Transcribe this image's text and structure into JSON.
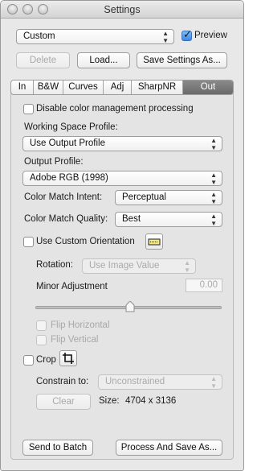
{
  "window": {
    "title": "Settings"
  },
  "top": {
    "preset_value": "Custom",
    "preview_label": "Preview",
    "preview_checked": true,
    "delete_label": "Delete",
    "load_label": "Load...",
    "save_label": "Save Settings As..."
  },
  "tabs": [
    {
      "label": "In"
    },
    {
      "label": "B&W"
    },
    {
      "label": "Curves"
    },
    {
      "label": "Adj"
    },
    {
      "label": "SharpNR"
    },
    {
      "label": "Out",
      "active": true
    }
  ],
  "out": {
    "disable_cm_label": "Disable color management processing",
    "working_space_label": "Working Space Profile:",
    "working_space_value": "Use Output Profile",
    "output_profile_label": "Output Profile:",
    "output_profile_value": "Adobe RGB (1998)",
    "match_intent_label": "Color Match Intent:",
    "match_intent_value": "Perceptual",
    "match_quality_label": "Color Match Quality:",
    "match_quality_value": "Best",
    "custom_orientation_label": "Use Custom Orientation",
    "rotation_label": "Rotation:",
    "rotation_value": "Use Image Value",
    "minor_adjustment_label": "Minor Adjustment",
    "minor_adjustment_value": "0.00",
    "flip_horizontal_label": "Flip Horizontal",
    "flip_vertical_label": "Flip Vertical",
    "crop_label": "Crop",
    "constrain_label": "Constrain to:",
    "constrain_value": "Unconstrained",
    "clear_label": "Clear",
    "size_label": "Size:",
    "size_value": "4704 x 3136"
  },
  "bottom": {
    "send_batch_label": "Send to Batch",
    "process_save_label": "Process And Save As..."
  }
}
